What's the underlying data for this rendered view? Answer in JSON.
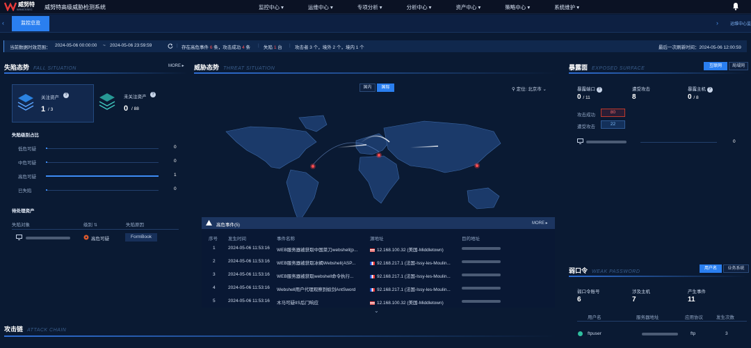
{
  "app": {
    "brand": "威努特",
    "brand_sub": "WINICSSEC",
    "title": "威努特高级威胁检测系统"
  },
  "nav": [
    "监控中心",
    "运维中心",
    "专项分析",
    "分析中心",
    "资产中心",
    "策略中心",
    "系统维护"
  ],
  "tabs": {
    "active": "监控总览",
    "right": "运维中心监"
  },
  "infobar": {
    "range_label": "当前数据时效范围：",
    "start": "2024-05-06 00:00:00",
    "sep": "~",
    "end": "2024-05-06 23:59:59",
    "events_a": "存在高危事件",
    "events_count": "6",
    "events_b": "条，攻击成功",
    "success_count": "4",
    "events_c": "条",
    "fallen_a": "失陷",
    "fallen_count": "1",
    "fallen_b": "台",
    "attackers": "攻击者 3 个，境外 2 个，境内 1 个",
    "last_update": "最后一次刷新时间：2024-05-06 12:00:59"
  },
  "fall": {
    "title": "失陷态势",
    "subtitle": "FALL SITUATION",
    "more": "MORE ▸",
    "focus_label": "关注资产",
    "focus_value": "1",
    "focus_total": "/ 3",
    "unfocus_label": "未关注资产",
    "unfocus_value": "0",
    "unfocus_total": "/ 88",
    "ratio_title": "失陷级别占比",
    "levels": [
      {
        "name": "低危可疑",
        "value": "0",
        "fill": 0.01
      },
      {
        "name": "中危可疑",
        "value": "0",
        "fill": 0.01
      },
      {
        "name": "高危可疑",
        "value": "1",
        "fill": 1.0
      },
      {
        "name": "已失陷",
        "value": "0",
        "fill": 0.01
      }
    ],
    "pending_title": "待处理资产",
    "cols": [
      "失陷对象",
      "级别",
      "失陷原因"
    ],
    "row": {
      "level": "高危可疑",
      "reason": "FormBook"
    }
  },
  "threat": {
    "title": "威胁态势",
    "subtitle": "THREAT SITUATION",
    "btn_domestic": "国内",
    "btn_intl": "国际",
    "locate": "定位: 北京市"
  },
  "events": {
    "title": "高危事件(5)",
    "more": "MORE ▸",
    "cols": [
      "序号",
      "发生时间",
      "事件名称",
      "源地址",
      "目的地址"
    ],
    "rows": [
      {
        "no": "1",
        "time": "2024-05-06 11:53:16",
        "name": "WEB服务器被获取中国菜刀webshell(p...",
        "src": "12.168.100.32 (美国-Middletown)",
        "flag": "us"
      },
      {
        "no": "2",
        "time": "2024-05-06 11:53:16",
        "name": "WEB服务器被获取冰蝎Webshell(ASP...",
        "src": "92.168.217.1 (法国-Issy-les-Moulin...",
        "flag": "fr"
      },
      {
        "no": "3",
        "time": "2024-05-06 11:53:16",
        "name": "WEB服务器被获取webshell命令执行...",
        "src": "92.168.217.1 (法国-Issy-les-Moulin...",
        "flag": "fr"
      },
      {
        "no": "4",
        "time": "2024-05-06 11:53:16",
        "name": "Webshell用户代理观察到蚁剑AntSword",
        "src": "92.168.217.1 (法国-Issy-les-Moulin...",
        "flag": "fr"
      },
      {
        "no": "5",
        "time": "2024-05-06 11:53:16",
        "name": "木马可疑IIS后门响应",
        "src": "12.168.100.32 (美国-Middletown)",
        "flag": "us"
      }
    ]
  },
  "exposed": {
    "title": "暴露面",
    "subtitle": "EXPOSED SURFACE",
    "btn_internet": "互联网",
    "btn_lan": "局域网",
    "stats": [
      {
        "label": "暴露端口",
        "value": "0",
        "total": "/ 11"
      },
      {
        "label": "遭受攻击",
        "value": "8",
        "total": ""
      },
      {
        "label": "暴露主机",
        "value": "0",
        "total": "/ 8"
      }
    ],
    "success_label": "攻击成功",
    "success_value": "80",
    "attacked_label": "遭受攻击",
    "attacked_value": "22",
    "host_value": "0"
  },
  "weak": {
    "title": "弱口令",
    "subtitle": "WEAK PASSWORD",
    "btn_user": "用户名",
    "btn_sys": "业务系统",
    "stats": [
      {
        "label": "弱口令账号",
        "value": "6"
      },
      {
        "label": "涉及主机",
        "value": "7"
      },
      {
        "label": "产生事件",
        "value": "11"
      }
    ],
    "cols": [
      "用户名",
      "服务器地址",
      "应用协议",
      "发生次数"
    ],
    "row": {
      "user": "ftpuser",
      "proto": "ftp",
      "count": "3"
    }
  },
  "attack_chain": {
    "title": "攻击链",
    "subtitle": "ATTACK CHAIN"
  },
  "colors": {
    "accent": "#2a7ff0",
    "danger": "#ff4d4f",
    "bg": "#0a1a33"
  }
}
